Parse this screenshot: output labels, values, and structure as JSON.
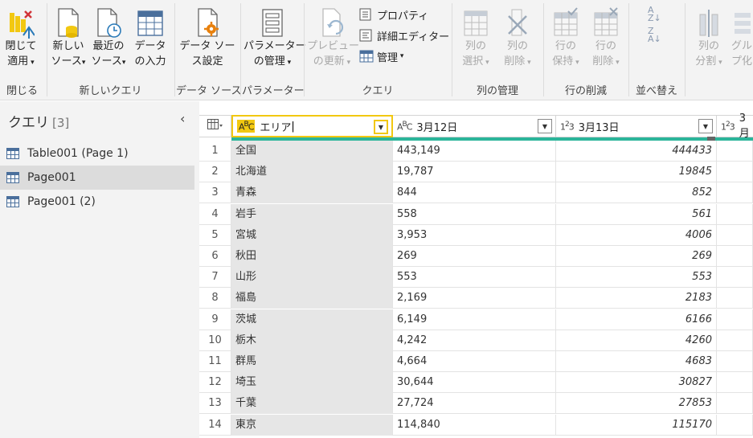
{
  "ribbon": {
    "groups": [
      {
        "label": "閉じる"
      },
      {
        "label": "新しいクエリ"
      },
      {
        "label": "データ ソース"
      },
      {
        "label": "パラメーター"
      },
      {
        "label": "クエリ"
      },
      {
        "label": "列の管理"
      },
      {
        "label": "行の削減"
      },
      {
        "label": "並べ替え"
      }
    ],
    "close_apply": {
      "l1": "閉じて",
      "l2": "適用"
    },
    "new_source": {
      "l1": "新しい",
      "l2": "ソース"
    },
    "recent_source": {
      "l1": "最近の",
      "l2": "ソース"
    },
    "enter_data": {
      "l1": "データ",
      "l2": "の入力"
    },
    "ds_settings": {
      "l1": "データ ソー",
      "l2": "ス設定"
    },
    "param_manage": {
      "l1": "パラメーター",
      "l2": "の管理"
    },
    "preview_refresh": {
      "l1": "プレビュー",
      "l2": "の更新"
    },
    "properties": "プロパティ",
    "advanced_editor": "詳細エディター",
    "manage": "管理",
    "choose_columns": {
      "l1": "列の",
      "l2": "選択"
    },
    "remove_columns": {
      "l1": "列の",
      "l2": "削除"
    },
    "keep_rows": {
      "l1": "行の",
      "l2": "保持"
    },
    "remove_rows": {
      "l1": "行の",
      "l2": "削除"
    },
    "split_column": {
      "l1": "列の",
      "l2": "分割"
    },
    "group_by": {
      "l1": "グル",
      "l2": "プ化"
    }
  },
  "queries": {
    "title": "クエリ",
    "count": "[3]",
    "items": [
      {
        "label": "Table001 (Page 1)"
      },
      {
        "label": "Page001"
      },
      {
        "label": "Page001 (2)"
      }
    ]
  },
  "grid": {
    "columns": [
      {
        "type": "ABC",
        "name": "エリア"
      },
      {
        "type": "ABC",
        "name": "3月12日"
      },
      {
        "type": "123",
        "name": "3月13日"
      },
      {
        "type": "123",
        "name": "3月"
      }
    ],
    "rows": [
      {
        "n": "1",
        "area": "全国",
        "d12": "443,149",
        "d13": "444433"
      },
      {
        "n": "2",
        "area": "北海道",
        "d12": "19,787",
        "d13": "19845"
      },
      {
        "n": "3",
        "area": "青森",
        "d12": "844",
        "d13": "852"
      },
      {
        "n": "4",
        "area": "岩手",
        "d12": "558",
        "d13": "561"
      },
      {
        "n": "5",
        "area": "宮城",
        "d12": "3,953",
        "d13": "4006"
      },
      {
        "n": "6",
        "area": "秋田",
        "d12": "269",
        "d13": "269"
      },
      {
        "n": "7",
        "area": "山形",
        "d12": "553",
        "d13": "553"
      },
      {
        "n": "8",
        "area": "福島",
        "d12": "2,169",
        "d13": "2183"
      },
      {
        "n": "9",
        "area": "茨城",
        "d12": "6,149",
        "d13": "6166"
      },
      {
        "n": "10",
        "area": "栃木",
        "d12": "4,242",
        "d13": "4260"
      },
      {
        "n": "11",
        "area": "群馬",
        "d12": "4,664",
        "d13": "4683"
      },
      {
        "n": "12",
        "area": "埼玉",
        "d12": "30,644",
        "d13": "30827"
      },
      {
        "n": "13",
        "area": "千葉",
        "d12": "27,724",
        "d13": "27853"
      },
      {
        "n": "14",
        "area": "東京",
        "d12": "114,840",
        "d13": "115170"
      }
    ]
  },
  "colors": {
    "accent": "#f2c811",
    "quality": "#2bb59a"
  }
}
